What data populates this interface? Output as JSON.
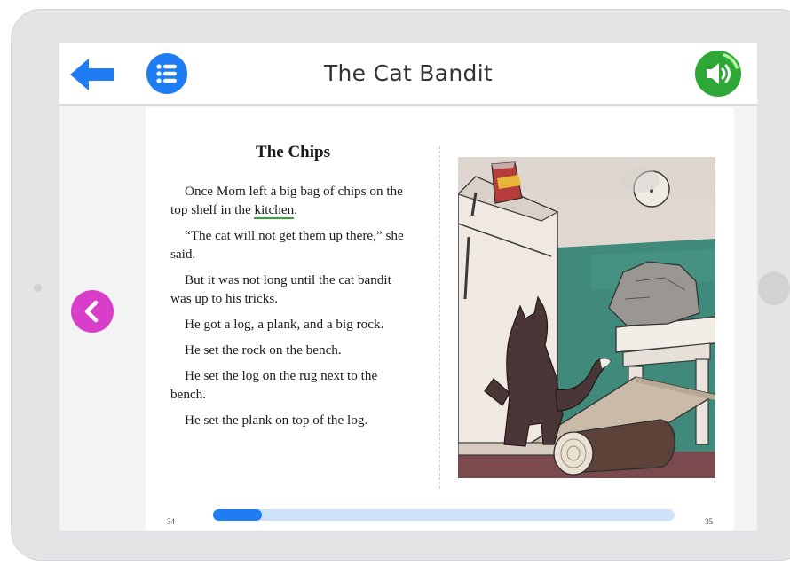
{
  "header": {
    "title": "The Cat Bandit"
  },
  "icons": {
    "back": "back-arrow-icon",
    "toc": "list-icon",
    "audio": "speaker-icon",
    "prev": "chevron-left-icon"
  },
  "colors": {
    "back_arrow": "#1f7cf2",
    "toc_button": "#1f7cf2",
    "audio_button": "#2da836",
    "prev_button": "#d93ecb",
    "vocab_underline": "#2da836",
    "progress_fill": "#1f7cf2",
    "progress_track": "#cde2f8"
  },
  "page": {
    "chapter_title": "The Chips",
    "paragraphs": [
      {
        "before": "Once Mom left a big bag of chips on the top shelf in the ",
        "word": "kitchen",
        "after": "."
      },
      {
        "text": "“The cat will not get them up there,” she said."
      },
      {
        "text": "But it was not long until the cat bandit was up to his tricks."
      },
      {
        "text": "He got a log, a plank, and a big rock."
      },
      {
        "text": "He set the rock on the bench."
      },
      {
        "text": "He set the log on the rug next to the bench."
      },
      {
        "text": "He set the plank on top of the log."
      }
    ],
    "left_page_number": "34",
    "right_page_number": "35"
  },
  "progress": {
    "fraction": 0.105
  }
}
